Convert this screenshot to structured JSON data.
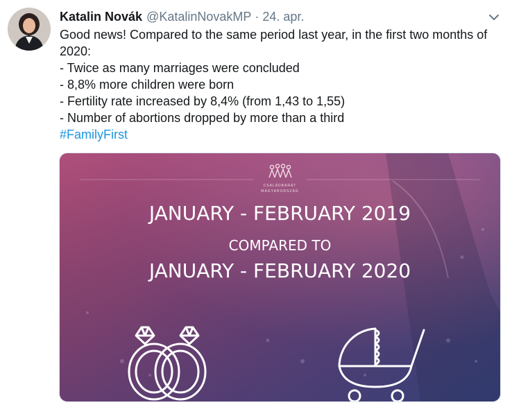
{
  "tweet": {
    "author_name": "Katalin Novák",
    "handle": "@KatalinNovakMP",
    "separator": "·",
    "date": "24. apr.",
    "text_lines": [
      "Good news! Compared to the same period last year, in the first two months of",
      "2020:",
      "- Twice as many marriages were concluded",
      "- 8,8% more children were born",
      "- Fertility rate increased by 8,4% (from 1,43 to 1,55)",
      "- Number of abortions dropped by more than a third"
    ],
    "hashtag": "#FamilyFirst"
  },
  "media": {
    "logo_line1": "CSALÁDBARÁT",
    "logo_line2": "MAGYARORSZÁG",
    "headline_1": "JANUARY - FEBRUARY 2019",
    "headline_2": "COMPARED TO",
    "headline_3": "JANUARY - FEBRUARY 2020",
    "icons": [
      "wedding-rings-icon",
      "baby-stroller-icon",
      "family-logo-icon"
    ]
  },
  "colors": {
    "text": "#14171a",
    "muted": "#657786",
    "link": "#1b95e0",
    "media_pink": "#b04f7a",
    "media_blue": "#3f4f8c"
  }
}
